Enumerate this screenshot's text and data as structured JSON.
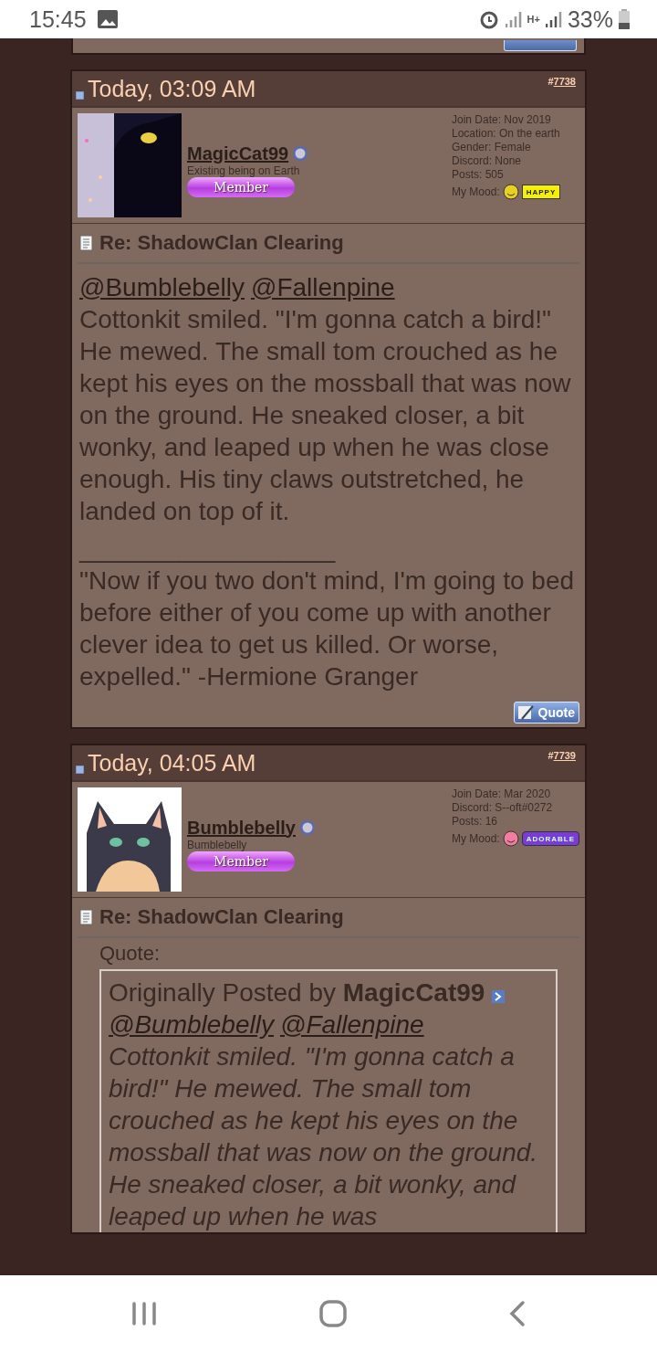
{
  "status_bar": {
    "time": "15:45",
    "network": "H+",
    "battery": "33%"
  },
  "posts": [
    {
      "date": "Today, 03:09 AM",
      "post_link": {
        "prefix": "#",
        "number": "7738"
      },
      "user": {
        "name": "MagicCat99",
        "title": "Existing being on Earth",
        "rank": "Member",
        "info": [
          "Join Date: Nov 2019",
          "Location: On the earth",
          "Gender: Female",
          "Discord: None",
          "Posts: 505"
        ],
        "mood_label": "My Mood:",
        "mood": {
          "kind": "happy",
          "text": "HAPPY"
        }
      },
      "title": "Re: ShadowClan Clearing",
      "mentions": [
        "@Bumblebelly",
        "@Fallenpine"
      ],
      "message": "Cottonkit smiled. \"I'm gonna catch a bird!\" He mewed. The small tom crouched as he kept his eyes on the mossball that was now on the ground. He sneaked closer, a bit wonky, and leaped up when he was close enough. His tiny claws outstretched, he landed on top of it.",
      "signature_rule": "__________________",
      "signature": "\"Now if you two don't mind, I'm going to bed before either of you come up with another clever idea to get us killed. Or worse, expelled.\" -Hermione Granger",
      "quote_button": "Quote"
    },
    {
      "date": "Today, 04:05 AM",
      "post_link": {
        "prefix": "#",
        "number": "7739"
      },
      "user": {
        "name": "Bumblebelly",
        "title": "Bumblebelly",
        "rank": "Member",
        "info": [
          "Join Date: Mar 2020",
          "Discord: S--oft#0272",
          "Posts: 16"
        ],
        "mood_label": "My Mood:",
        "mood": {
          "kind": "adorable",
          "text": "ADORABLE"
        }
      },
      "title": "Re: ShadowClan Clearing",
      "quote": {
        "label": "Quote:",
        "author_prefix": "Originally Posted by",
        "author": "MagicCat99",
        "mentions": [
          "@Bumblebelly",
          "@Fallenpine"
        ],
        "text": "Cottonkit smiled. \"I'm gonna catch a bird!\" He mewed. The small tom crouched as he kept his eyes on the mossball that was now on the ground. He sneaked closer, a bit wonky, and leaped up when he was"
      }
    }
  ]
}
